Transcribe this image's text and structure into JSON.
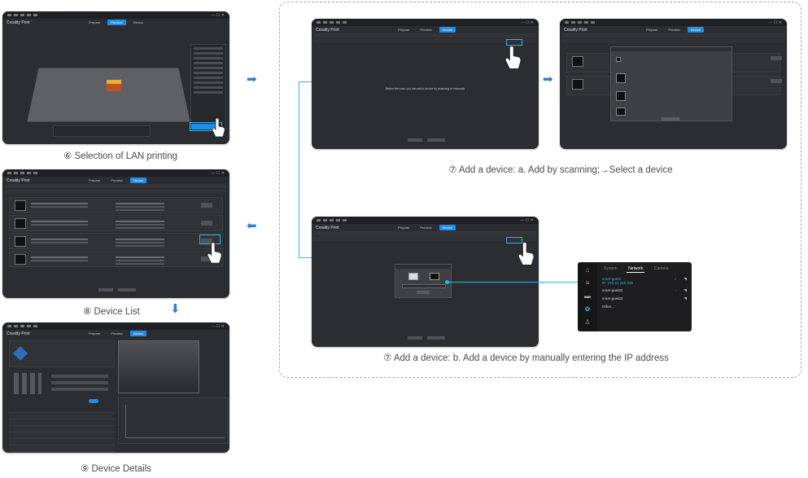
{
  "captions": {
    "lan": "⑥ Selection of LAN printing",
    "add_scan": "⑦ Add a device: a. Add by scanning;→Select a device",
    "add_ip": "⑦ Add a device: b. Add a device by manually entering the IP address",
    "device_list": "⑧ Device List",
    "device_details": "⑨ Device Details"
  },
  "app": {
    "title": "Creality Print",
    "tabs": [
      "Prepare",
      "Preview",
      "Device"
    ],
    "active_tab": "Device"
  },
  "scan_screen": {
    "empty_message": "Before first use, you can add a device by scanning or manually"
  },
  "network_panel": {
    "tabs": [
      "System",
      "Network",
      "Camera"
    ],
    "active_tab": "Network",
    "networks": [
      {
        "name": "crear-guest",
        "ip": "IP: 172.21.219.226",
        "selected": true
      },
      {
        "name": "crear-guest2",
        "selected": false
      },
      {
        "name": "crear-guest3",
        "selected": false
      },
      {
        "name": "Other...",
        "selected": false
      }
    ]
  },
  "icons": {
    "arrow_right": "arrow-right-icon",
    "arrow_left": "arrow-left-icon",
    "arrow_down": "arrow-down-icon",
    "hand": "hand-pointer-icon",
    "home": "home-icon",
    "wifi": "wifi-icon",
    "check": "check-icon"
  },
  "colors": {
    "accent": "#1f8ee6",
    "highlight": "#2fb8e6",
    "arrow": "#2f7fd4",
    "window_bg": "#2b2d31"
  }
}
